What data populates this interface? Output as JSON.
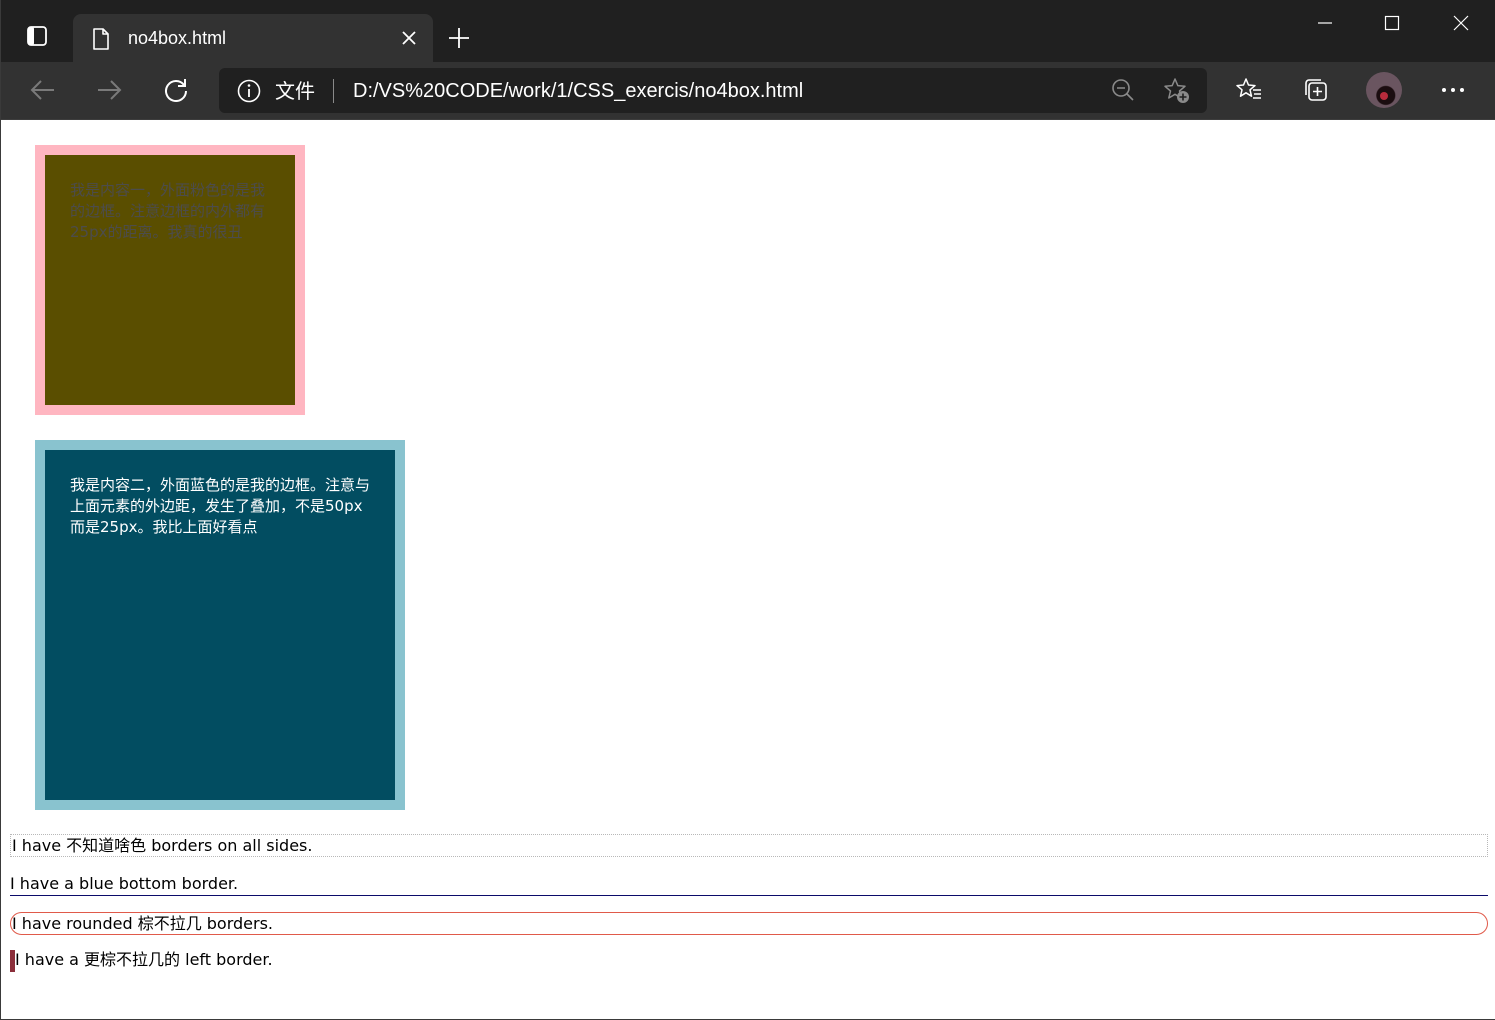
{
  "browser": {
    "tab": {
      "title": "no4box.html"
    },
    "address_bar": {
      "scheme_label": "文件",
      "url": "D:/VS%20CODE/work/1/CSS_exercis/no4box.html"
    },
    "icons": {
      "tab_actions": "tab-actions-icon",
      "tab_page": "document-icon",
      "tab_close": "close-icon",
      "new_tab": "plus-icon",
      "minimize": "minimize-icon",
      "maximize": "maximize-icon",
      "close_window": "close-icon",
      "back": "arrow-left-icon",
      "forward": "arrow-right-icon",
      "refresh": "refresh-icon",
      "site_info": "info-icon",
      "zoom": "zoom-out-icon",
      "add_favorite": "star-plus-icon",
      "favorites": "favorites-list-icon",
      "collections": "collections-icon",
      "profile": "avatar",
      "more": "ellipsis-icon"
    }
  },
  "page": {
    "box1": {
      "text": "我是内容一，外面粉色的是我的边框。注意边框的内外都有25px的距离。我真的很丑",
      "border_color": "#ffb6c1",
      "background_color": "#5a4e00"
    },
    "box2": {
      "text": "我是内容二，外面蓝色的是我的边框。注意与上面元素的外边距，发生了叠加，不是50px而是25px。我比上面好看点",
      "border_color": "#89c3cf",
      "background_color": "#024d61"
    },
    "paragraphs": [
      "I have 不知道啥色 borders on all sides.",
      "I have a blue bottom border.",
      "I have rounded 棕不拉几 borders.",
      "I have a 更棕不拉几的 left border."
    ]
  }
}
